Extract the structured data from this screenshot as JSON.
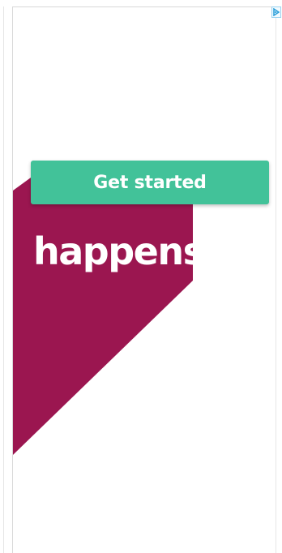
{
  "ad": {
    "cta_label": "Get started",
    "headline_fragment": "happens.",
    "adchoices_icon": "adchoices-triangle-icon"
  },
  "colors": {
    "cta_background": "#42c299",
    "hero_shape": "#9b1650",
    "text_on_color": "#ffffff",
    "page_background": "#ffffff"
  }
}
